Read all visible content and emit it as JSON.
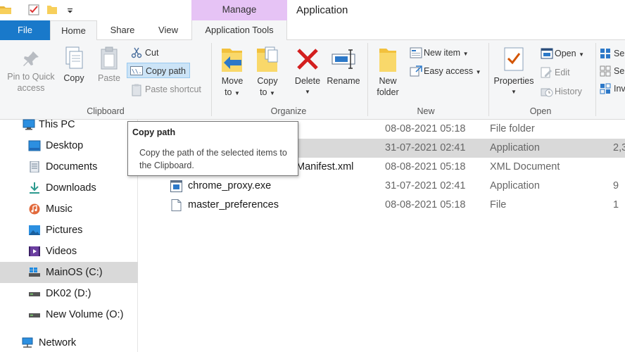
{
  "title_bar": {
    "contextual_tab": "Manage",
    "window_title": "Application",
    "qat_icons": [
      "folder-icon",
      "properties-check-icon",
      "new-folder-icon",
      "customize-dropdown-icon"
    ]
  },
  "ribbon_tabs": {
    "file": "File",
    "home": "Home",
    "share": "Share",
    "view": "View",
    "app_tools": "Application Tools"
  },
  "clipboard": {
    "pin_line1": "Pin to Quick",
    "pin_line2": "access",
    "copy": "Copy",
    "paste": "Paste",
    "cut": "Cut",
    "copy_path": "Copy path",
    "paste_shortcut": "Paste shortcut",
    "label": "Clipboard"
  },
  "organize": {
    "move_line1": "Move",
    "move_line2": "to",
    "copy_line1": "Copy",
    "copy_line2": "to",
    "delete": "Delete",
    "rename": "Rename",
    "label": "Organize"
  },
  "new_group": {
    "new_folder_line1": "New",
    "new_folder_line2": "folder",
    "new_item": "New item",
    "easy_access": "Easy access",
    "label": "New"
  },
  "open_group": {
    "properties": "Properties",
    "open": "Open",
    "edit": "Edit",
    "history": "History",
    "label": "Open"
  },
  "select_group": {
    "select_all": "Se",
    "select_none": "Se",
    "invert": "Inv"
  },
  "tooltip": {
    "title": "Copy path",
    "description": "Copy the path of the selected items to the Clipboard."
  },
  "nav": {
    "this_pc": "This PC",
    "desktop": "Desktop",
    "documents": "Documents",
    "downloads": "Downloads",
    "music": "Music",
    "pictures": "Pictures",
    "videos": "Videos",
    "mainos": "MainOS (C:)",
    "dk02": "DK02 (D:)",
    "new_volume": "New Volume (O:)",
    "network": "Network"
  },
  "files": [
    {
      "name": "",
      "date": "08-08-2021 05:18",
      "type": "File folder",
      "size": ""
    },
    {
      "name": "",
      "date": "31-07-2021 02:41",
      "type": "Application",
      "size": "2,3"
    },
    {
      "name": "Manifest.xml",
      "date": "08-08-2021 05:18",
      "type": "XML Document",
      "size": ""
    },
    {
      "name": "chrome_proxy.exe",
      "date": "31-07-2021 02:41",
      "type": "Application",
      "size": "9"
    },
    {
      "name": "master_preferences",
      "date": "08-08-2021 05:18",
      "type": "File",
      "size": "1"
    }
  ],
  "colors": {
    "file_tab": "#1979ca",
    "manage_tab": "#e6c3f5",
    "ribbon_bg": "#f5f6f7",
    "selection": "#d9d9d9",
    "highlight": "#cce4f7"
  }
}
